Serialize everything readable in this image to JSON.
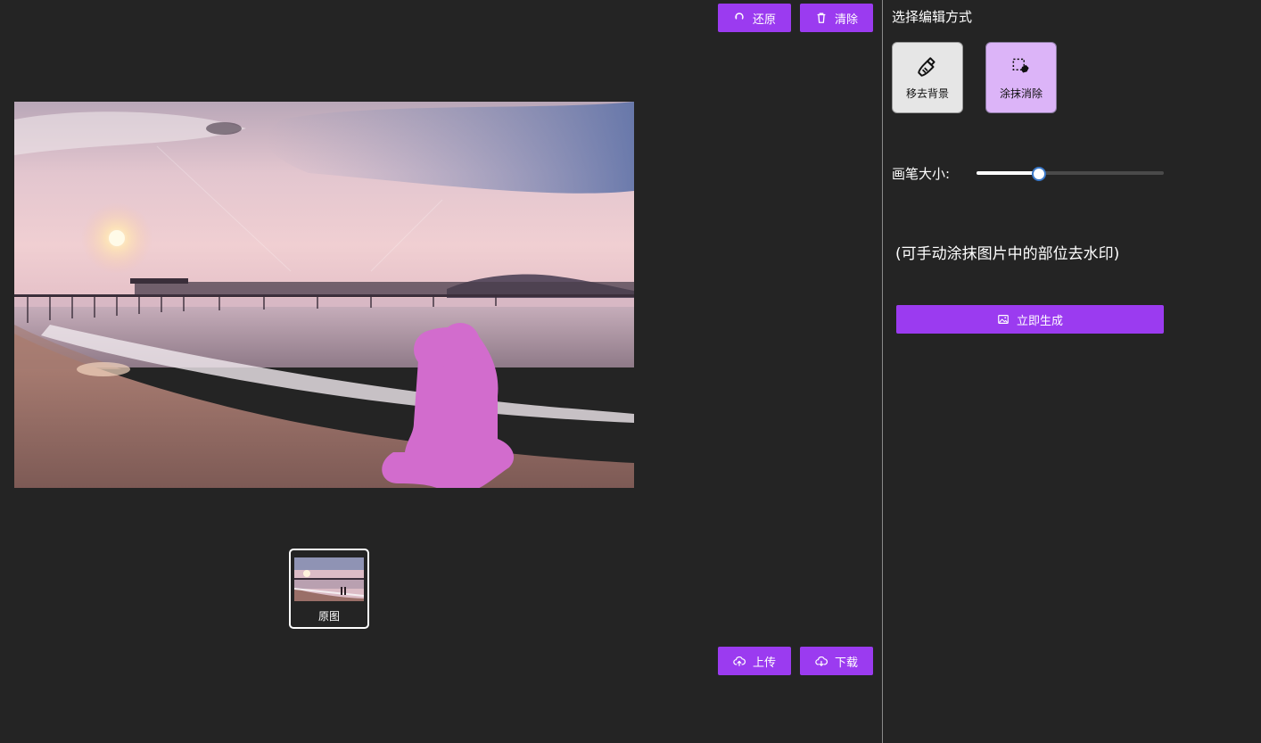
{
  "toolbar": {
    "restore_label": "还原",
    "clear_label": "清除",
    "upload_label": "上传",
    "download_label": "下载",
    "accent_color": "#9b3bf0"
  },
  "thumbnails": [
    {
      "label": "原图",
      "selected": true
    }
  ],
  "panel": {
    "title": "选择编辑方式",
    "modes": [
      {
        "label": "移去背景",
        "icon": "broom-icon",
        "selected": false
      },
      {
        "label": "涂抹消除",
        "icon": "eraser-icon",
        "selected": true
      }
    ],
    "brush_size_label": "画笔大小:",
    "brush_size_level": 0.33,
    "hint": "(可手动涂抹图片中的部位去水印)",
    "generate_label": "立即生成"
  },
  "colors": {
    "background": "#242424",
    "smear_mask": "#d26ccd",
    "selected_mode": "#dcb4f8"
  }
}
